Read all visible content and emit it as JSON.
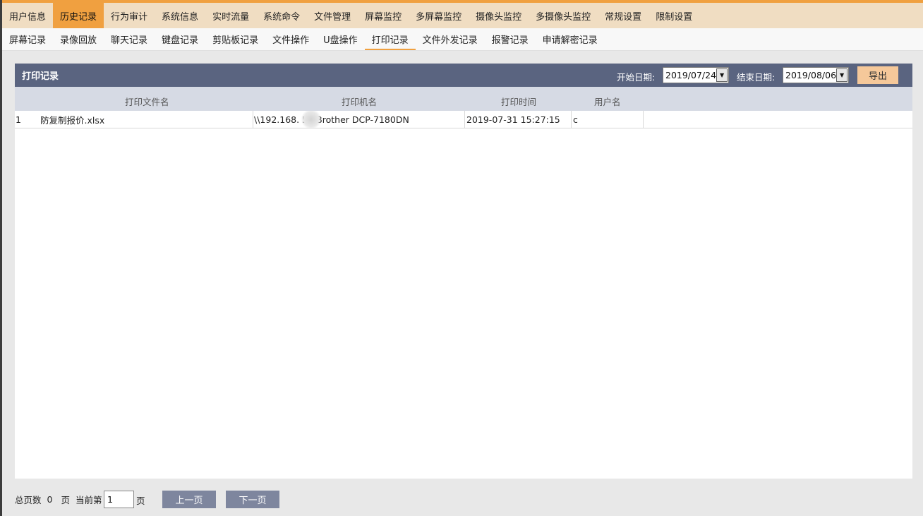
{
  "main_nav": [
    {
      "label": "用户信息",
      "active": false
    },
    {
      "label": "历史记录",
      "active": true
    },
    {
      "label": "行为审计",
      "active": false
    },
    {
      "label": "系统信息",
      "active": false
    },
    {
      "label": "实时流量",
      "active": false
    },
    {
      "label": "系统命令",
      "active": false
    },
    {
      "label": "文件管理",
      "active": false
    },
    {
      "label": "屏幕监控",
      "active": false
    },
    {
      "label": "多屏幕监控",
      "active": false
    },
    {
      "label": "摄像头监控",
      "active": false
    },
    {
      "label": "多摄像头监控",
      "active": false
    },
    {
      "label": "常规设置",
      "active": false
    },
    {
      "label": "限制设置",
      "active": false
    }
  ],
  "sub_nav": [
    {
      "label": "屏幕记录",
      "active": false
    },
    {
      "label": "录像回放",
      "active": false
    },
    {
      "label": "聊天记录",
      "active": false
    },
    {
      "label": "键盘记录",
      "active": false
    },
    {
      "label": "剪贴板记录",
      "active": false
    },
    {
      "label": "文件操作",
      "active": false
    },
    {
      "label": "U盘操作",
      "active": false
    },
    {
      "label": "打印记录",
      "active": true
    },
    {
      "label": "文件外发记录",
      "active": false
    },
    {
      "label": "报警记录",
      "active": false
    },
    {
      "label": "申请解密记录",
      "active": false
    }
  ],
  "panel": {
    "title": "打印记录",
    "start_label": "开始日期:",
    "start_date": "2019/07/24",
    "end_label": "结束日期:",
    "end_date": "2019/08/06",
    "export_label": "导出"
  },
  "table": {
    "columns": [
      "打印文件名",
      "打印机名",
      "打印时间",
      "用户名"
    ],
    "rows": [
      {
        "index": "1",
        "file": "防复制报价.xlsx",
        "printer": "\\\\192.168.      55\\Brother DCP-7180DN",
        "time": "2019-07-31 15:27:15",
        "user": "c"
      }
    ]
  },
  "footer": {
    "total_label": "总页数",
    "total_pages": "0",
    "page_unit": "页",
    "current_label": "当前第",
    "current_page": "1",
    "current_unit": "页",
    "prev_label": "上一页",
    "next_label": "下一页"
  }
}
